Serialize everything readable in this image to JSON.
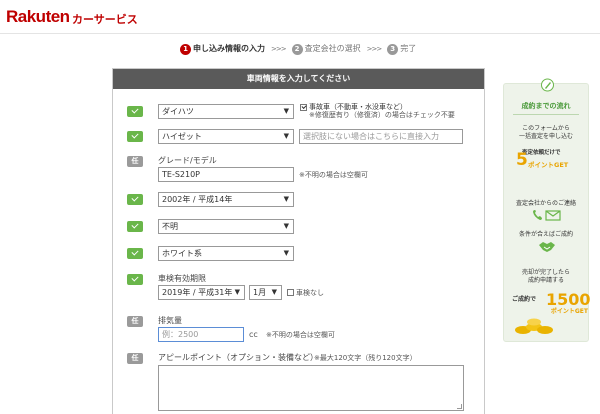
{
  "header": {
    "logo": "Rakuten",
    "service": "カーサービス"
  },
  "steps": [
    {
      "num": "1",
      "label": "申し込み情報の入力",
      "sep": ">>>"
    },
    {
      "num": "2",
      "label": "査定会社の選択",
      "sep": ">>>"
    },
    {
      "num": "3",
      "label": "完了"
    }
  ],
  "form": {
    "heading": "車両情報を入力してください",
    "badge_optional": "任",
    "maker": {
      "value": "ダイハツ"
    },
    "maker_note": "事故車（不動車・水没車など）",
    "maker_note2": "※修復歴有り（修復済）の場合はチェック不要",
    "model": {
      "value": "ハイゼット"
    },
    "model_free_placeholder": "選択肢にない場合はこちらに直接入力",
    "grade": {
      "label": "グレード/モデル",
      "value": "TE-S210P",
      "note": "※不明の場合は空欄可"
    },
    "year": {
      "value": "2002年 / 平成14年"
    },
    "mileage": {
      "value": "不明"
    },
    "color": {
      "value": "ホワイト系"
    },
    "inspection": {
      "label": "車検有効期限",
      "year": "2019年 / 平成31年",
      "month": "1月",
      "none_label": "車検なし"
    },
    "displacement": {
      "label": "排気量",
      "placeholder": "例：2500",
      "unit": "cc",
      "note": "※不明の場合は空欄可"
    },
    "appeal": {
      "label": "アピールポイント（オプション・装備など）",
      "limit": "※最大120文字（残り120文字）"
    }
  },
  "sidebar": {
    "title": "成約までの流れ",
    "step1": [
      "このフォームから",
      "一括査定を申し込む"
    ],
    "step1_badge": [
      "査定依頼だけで",
      "5",
      "ポイントGET"
    ],
    "step2": "査定会社からのご連絡",
    "step3": "条件が合えばご成約",
    "step4": [
      "売却が完了したら",
      "成約申請する"
    ],
    "step4_badge": [
      "ご成約で",
      "1500",
      "ポイントGET"
    ]
  },
  "colors": {
    "brand": "#bf0000",
    "check": "#6ab64a",
    "panel_head": "#5a5a5a",
    "sidebar_bg": "#eef3ea"
  },
  "icons": {
    "complete": "check-icon",
    "optional": "optional-badge",
    "sidebar_clip": "pencil-icon",
    "phone": "phone-icon",
    "mail": "mail-icon",
    "handshake": "handshake-icon",
    "coins": "coins-icon"
  }
}
